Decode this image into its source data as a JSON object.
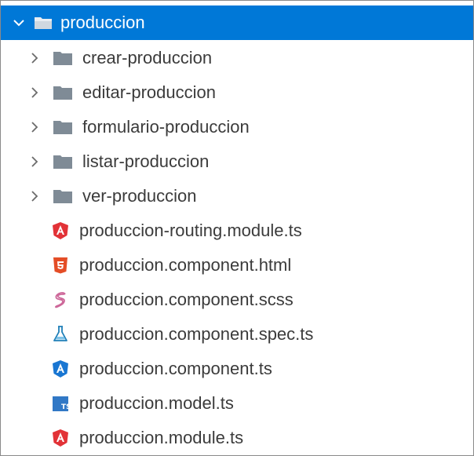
{
  "tree": {
    "root": {
      "label": "produccion",
      "icon": "folder-open-icon",
      "expanded": true
    },
    "folders": [
      {
        "label": "crear-produccion",
        "icon": "folder-icon"
      },
      {
        "label": "editar-produccion",
        "icon": "folder-icon"
      },
      {
        "label": "formulario-produccion",
        "icon": "folder-icon"
      },
      {
        "label": "listar-produccion",
        "icon": "folder-icon"
      },
      {
        "label": "ver-produccion",
        "icon": "folder-icon"
      }
    ],
    "files": [
      {
        "label": "produccion-routing.module.ts",
        "icon": "angular-red-icon"
      },
      {
        "label": "produccion.component.html",
        "icon": "html5-icon"
      },
      {
        "label": "produccion.component.scss",
        "icon": "sass-icon"
      },
      {
        "label": "produccion.component.spec.ts",
        "icon": "flask-icon"
      },
      {
        "label": "produccion.component.ts",
        "icon": "angular-blue-icon"
      },
      {
        "label": "produccion.model.ts",
        "icon": "typescript-icon"
      },
      {
        "label": "produccion.module.ts",
        "icon": "angular-red-icon"
      }
    ]
  },
  "colors": {
    "selection": "#0078d7",
    "folder": "#7f8b96",
    "angular_red": "#e23237",
    "angular_blue": "#1976d2",
    "html5": "#e44d26",
    "sass": "#cd6799",
    "flask": "#1f7fb8",
    "typescript": "#3178c6"
  }
}
